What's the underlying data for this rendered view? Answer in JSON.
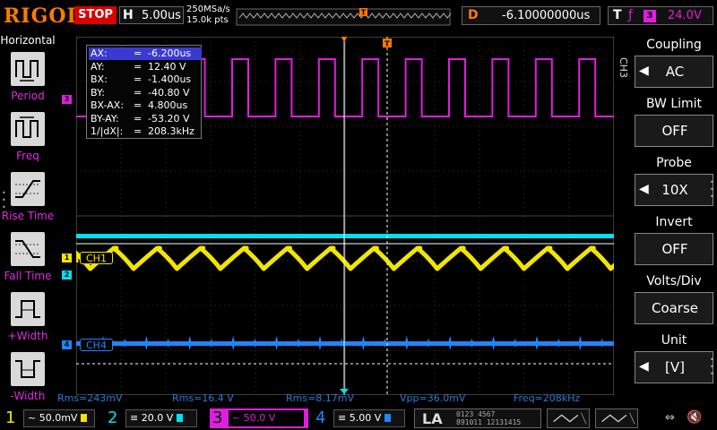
{
  "topbar": {
    "logo": "RIGOL",
    "run_state": "STOP",
    "horizontal_label": "H",
    "timebase": "5.00us",
    "sample_rate": "250MSa/s",
    "memory_depth": "15.0k pts",
    "trigger_marker": "T",
    "delay_label": "D",
    "delay_value": "-6.10000000us",
    "trigger_label": "T",
    "trigger_edge": "ƒ",
    "trigger_source": "3",
    "trigger_level": "24.0V"
  },
  "leftpanel": {
    "title": "Horizontal",
    "items": [
      {
        "label": "Period",
        "icon": "period-measure-icon"
      },
      {
        "label": "Freq",
        "icon": "frequency-measure-icon"
      },
      {
        "label": "Rise Time",
        "icon": "rise-time-icon"
      },
      {
        "label": "Fall Time",
        "icon": "fall-time-icon"
      },
      {
        "label": "+Width",
        "icon": "positive-width-icon"
      },
      {
        "label": "-Width",
        "icon": "negative-width-icon"
      }
    ]
  },
  "cursor_table": {
    "rows": [
      {
        "key": "AX:",
        "eq": "=",
        "value": "-6.200us"
      },
      {
        "key": "AY:",
        "eq": "=",
        "value": "12.40 V"
      },
      {
        "key": "BX:",
        "eq": "=",
        "value": "-1.400us"
      },
      {
        "key": "BY:",
        "eq": "=",
        "value": "-40.80 V"
      },
      {
        "key": "BX-AX:",
        "eq": "=",
        "value": "4.800us"
      },
      {
        "key": "BY-AY:",
        "eq": "=",
        "value": "-53.20 V"
      },
      {
        "key": "1/|dX|:",
        "eq": "=",
        "value": "208.3kHz"
      }
    ]
  },
  "channels": {
    "ch1_marker": "1",
    "ch1_tag": "CH1",
    "ch2_marker": "2",
    "ch3_marker": "3",
    "ch4_marker": "4",
    "ch4_tag": "CH4"
  },
  "measurements": [
    {
      "text": "Rms=243mV"
    },
    {
      "text": "Rms=16.4 V"
    },
    {
      "text": "Rms=8.17mV"
    },
    {
      "text": "Vpp=36.0mV"
    },
    {
      "text": "Freq=208kHz"
    }
  ],
  "rightpanel": {
    "channel": "CH3",
    "items": [
      {
        "label": "Coupling",
        "value": "AC",
        "arrow": true
      },
      {
        "label": "BW Limit",
        "value": "OFF",
        "arrow": false
      },
      {
        "label": "Probe",
        "value": "10X",
        "arrow": true
      },
      {
        "label": "Invert",
        "value": "OFF",
        "arrow": false
      },
      {
        "label": "Volts/Div",
        "value": "Coarse",
        "arrow": false
      },
      {
        "label": "Unit",
        "value": "[V]",
        "arrow": true
      }
    ]
  },
  "bottombar": {
    "ch1": {
      "num": "1",
      "scale": "~ 50.0mV"
    },
    "ch2": {
      "num": "2",
      "scale": "≡ 20.0 V"
    },
    "ch3": {
      "num": "3",
      "scale": "~ 50.0 V"
    },
    "ch4": {
      "num": "4",
      "scale": "≡ 5.00 V"
    },
    "la": "LA",
    "la_bits_row1": "0123 4567",
    "la_bits_row2": "891011 12131415"
  },
  "colors": {
    "ch1": "#f2e600",
    "ch2": "#00e1f0",
    "ch3": "#e01de0",
    "ch4": "#1e86ff",
    "accent": "#ff7a00",
    "measurement": "#2a7ad8"
  }
}
